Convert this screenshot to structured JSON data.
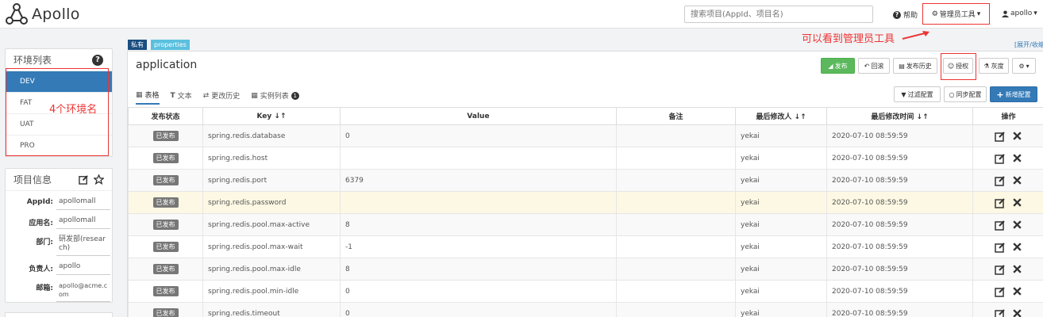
{
  "brand": {
    "name": "Apollo"
  },
  "navbar": {
    "search_placeholder": "搜索项目(AppId、项目名)",
    "help_label": "帮助",
    "admin_tools_label": "管理员工具",
    "user_label": "apollo"
  },
  "annotations": {
    "admin_note": "可以看到管理员工具",
    "env_note": "4个环境名"
  },
  "env_panel": {
    "title": "环境列表",
    "items": [
      {
        "label": "DEV",
        "active": true
      },
      {
        "label": "FAT",
        "active": false
      },
      {
        "label": "UAT",
        "active": false
      },
      {
        "label": "PRO",
        "active": false
      }
    ]
  },
  "info_panel": {
    "title": "项目信息",
    "rows": [
      {
        "label": "AppId:",
        "value": "apollomall"
      },
      {
        "label": "应用名:",
        "value": "apollomall"
      },
      {
        "label": "部门:",
        "value": "研发部(research)"
      },
      {
        "label": "负责人:",
        "value": "apollo"
      },
      {
        "label": "邮箱:",
        "value": "apollo@acme.com"
      }
    ]
  },
  "namespace": {
    "scope_tag": "私有",
    "format_tag": "properties",
    "expand_label": "[展开/收缩]",
    "title": "application"
  },
  "toolbar": {
    "publish": "发布",
    "rollback": "回滚",
    "history": "发布历史",
    "authorize": "授权",
    "gray": "灰度",
    "filter": "过滤配置",
    "sync": "同步配置",
    "add": "新增配置"
  },
  "tabs": [
    {
      "label": "表格",
      "icon": "table-icon",
      "active": true
    },
    {
      "label": "文本",
      "icon": "text-icon",
      "active": false
    },
    {
      "label": "更改历史",
      "icon": "history-icon",
      "active": false
    },
    {
      "label": "实例列表",
      "icon": "instance-icon",
      "active": false,
      "badge": "1"
    }
  ],
  "table": {
    "headers": [
      "发布状态",
      "Key ↓↑",
      "Value",
      "备注",
      "最后修改人 ↓↑",
      "最后修改时间 ↓↑",
      "操作"
    ],
    "rows": [
      {
        "status": "已发布",
        "key": "spring.redis.database",
        "value": "0",
        "comment": "",
        "modifier": "yekai",
        "time": "2020-07-10 08:59:59"
      },
      {
        "status": "已发布",
        "key": "spring.redis.host",
        "value": "",
        "comment": "",
        "modifier": "yekai",
        "time": "2020-07-10 08:59:59"
      },
      {
        "status": "已发布",
        "key": "spring.redis.port",
        "value": "6379",
        "comment": "",
        "modifier": "yekai",
        "time": "2020-07-10 08:59:59"
      },
      {
        "status": "已发布",
        "key": "spring.redis.password",
        "value": "",
        "comment": "",
        "modifier": "yekai",
        "time": "2020-07-10 08:59:59",
        "highlight": true
      },
      {
        "status": "已发布",
        "key": "spring.redis.pool.max-active",
        "value": "8",
        "comment": "",
        "modifier": "yekai",
        "time": "2020-07-10 08:59:59"
      },
      {
        "status": "已发布",
        "key": "spring.redis.pool.max-wait",
        "value": "-1",
        "comment": "",
        "modifier": "yekai",
        "time": "2020-07-10 08:59:59"
      },
      {
        "status": "已发布",
        "key": "spring.redis.pool.max-idle",
        "value": "8",
        "comment": "",
        "modifier": "yekai",
        "time": "2020-07-10 08:59:59"
      },
      {
        "status": "已发布",
        "key": "spring.redis.pool.min-idle",
        "value": "0",
        "comment": "",
        "modifier": "yekai",
        "time": "2020-07-10 08:59:59"
      },
      {
        "status": "已发布",
        "key": "spring.redis.timeout",
        "value": "0",
        "comment": "",
        "modifier": "yekai",
        "time": "2020-07-10 08:59:59"
      }
    ]
  },
  "colors": {
    "primary": "#337ab7",
    "success": "#5cb85c",
    "annotation_red": "#ee3333",
    "row_highlight": "#fcf8e3"
  }
}
